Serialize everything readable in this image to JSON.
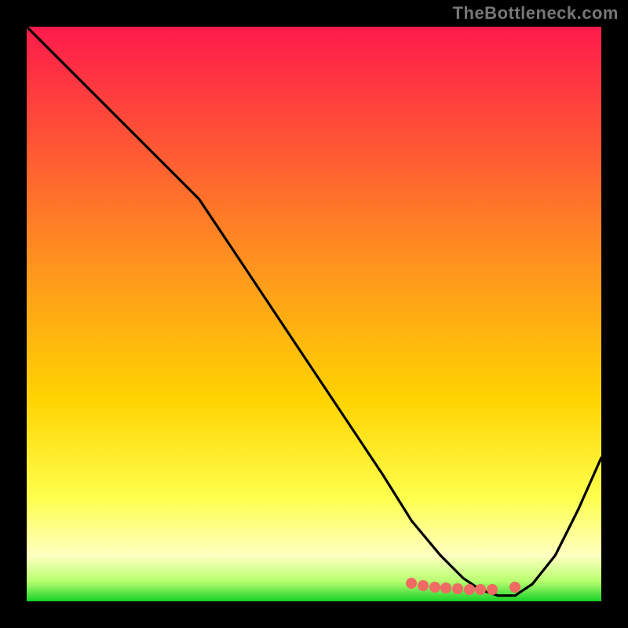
{
  "watermark": "TheBottleneck.com",
  "chart_data": {
    "type": "line",
    "title": "",
    "xlabel": "",
    "ylabel": "",
    "xlim": [
      0,
      100
    ],
    "ylim": [
      0,
      100
    ],
    "grid": false,
    "background_gradient": {
      "top": "#ff1a4b",
      "mid": "#ffd400",
      "bottom_pale": "#ffffb0",
      "green": "#17d128"
    },
    "series": [
      {
        "name": "bottleneck-curve",
        "color": "#000000",
        "x": [
          0,
          8,
          16,
          23,
          30,
          38,
          46,
          54,
          62,
          67,
          72,
          76,
          79,
          82,
          85,
          88,
          92,
          96,
          100
        ],
        "y": [
          100,
          92,
          84,
          77,
          70,
          58,
          46,
          34,
          22,
          14,
          8,
          4,
          2,
          1,
          1,
          3,
          8,
          16,
          25
        ]
      }
    ],
    "markers": {
      "name": "highlight-points",
      "color": "#ef6a63",
      "x": [
        67,
        69,
        71,
        73,
        75,
        77,
        79,
        81,
        85
      ],
      "y": [
        3.2,
        2.8,
        2.5,
        2.3,
        2.2,
        2.1,
        2.0,
        2.0,
        2.4
      ]
    }
  }
}
